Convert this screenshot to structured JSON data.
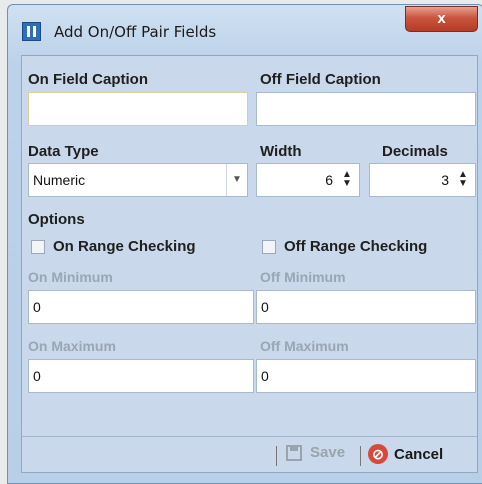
{
  "window": {
    "title": "Add On/Off Pair Fields",
    "close_label": "x"
  },
  "form": {
    "on_caption_label": "On Field Caption",
    "off_caption_label": "Off Field Caption",
    "on_caption_value": "",
    "off_caption_value": "",
    "data_type_label": "Data Type",
    "data_type_value": "Numeric",
    "width_label": "Width",
    "width_value": "6",
    "decimals_label": "Decimals",
    "decimals_value": "3",
    "options_label": "Options",
    "on_range_label": "On Range Checking",
    "off_range_label": "Off Range Checking",
    "on_minimum_label": "On Minimum",
    "off_minimum_label": "Off Minimum",
    "on_minimum_value": "0",
    "off_minimum_value": "0",
    "on_maximum_label": "On Maximum",
    "off_maximum_label": "Off Maximum",
    "on_maximum_value": "0",
    "off_maximum_value": "0"
  },
  "footer": {
    "save_label": "Save",
    "cancel_label": "Cancel"
  }
}
